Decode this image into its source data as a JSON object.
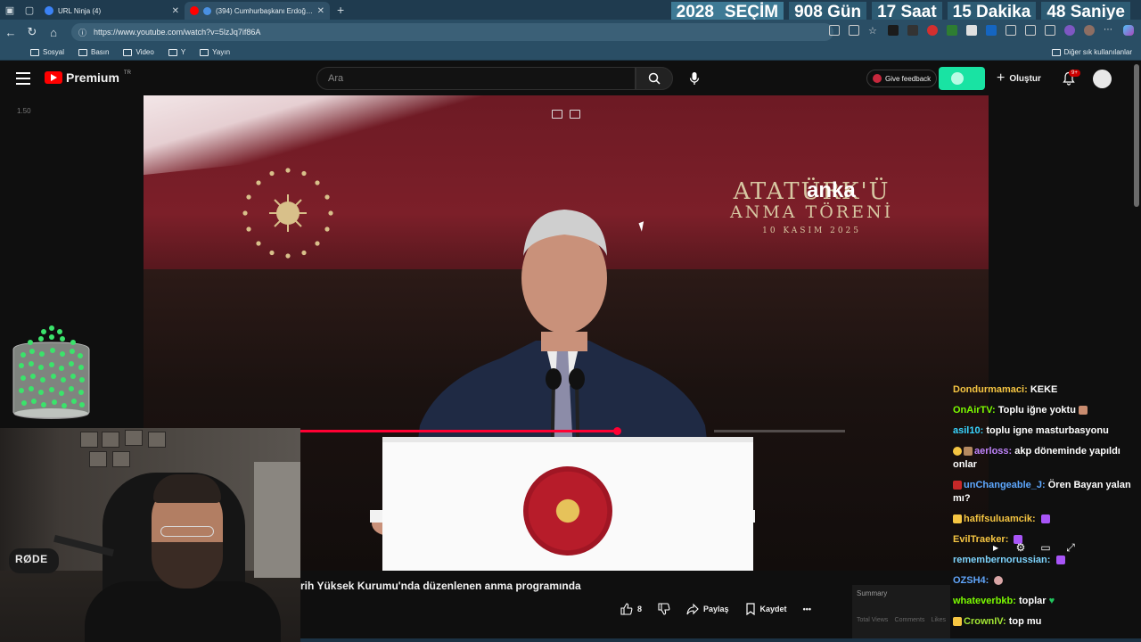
{
  "browser": {
    "tabs": [
      {
        "title": "URL Ninja (4)",
        "active": false,
        "fav_color": "#3b82f6"
      },
      {
        "title": "(394) Cumhurbaşkanı Erdoğ…",
        "active": true,
        "fav_color": "#ff0000"
      }
    ],
    "url": "https://www.youtube.com/watch?v=5lzJq7if86A",
    "bookmarks": [
      "Sosyal",
      "Basın",
      "Video",
      "Y",
      "Yayın"
    ],
    "bookmarks_right": "Diğer sık kullanılanlar"
  },
  "countdown": {
    "year": "2028",
    "label": "SEÇİM",
    "days": "908 Gün",
    "hours": "17 Saat",
    "minutes": "15 Dakika",
    "seconds": "48 Saniye"
  },
  "youtube": {
    "logo_text": "Premium",
    "logo_sup": "TR",
    "search_placeholder": "Ara",
    "feedback_label": "Give feedback",
    "create_label": "Oluştur",
    "notif_badge": "9+",
    "speed_label": "1.50"
  },
  "video": {
    "wall_title_line1": "ATATÜRK'Ü",
    "wall_title_line2": "ANMA TÖRENİ",
    "wall_title_line3": "10 KASIM 2025",
    "watermark": "anka",
    "progress": 0.68
  },
  "below": {
    "title": "rih Yüksek Kurumu'nda düzenlenen anma programında",
    "likes": "8",
    "share_label": "Paylaş",
    "save_label": "Kaydet",
    "summary_label": "Summary",
    "summary_col1": "Total Views",
    "summary_col2": "Comments",
    "summary_col3": "Likes"
  },
  "webcam": {
    "mic_brand": "RØDE"
  },
  "chat": [
    {
      "user": "Dondurmamaci:",
      "text": "KEKE",
      "color": "#f5c542"
    },
    {
      "user": "OnAirTV:",
      "text": "Toplu iğne yoktu",
      "color": "#7cfc00"
    },
    {
      "user": "asil10:",
      "text": "toplu igne masturbasyonu",
      "color": "#39d5ff"
    },
    {
      "user": "aerloss:",
      "text": "akp döneminde yapıldı onlar",
      "color": "#c084fc"
    },
    {
      "user": "unChangeable_J:",
      "text": "Ören Bayan yalan mı?",
      "color": "#5ea8ff"
    },
    {
      "user": "hafifsuluamcik:",
      "text": "",
      "color": "#f5c542"
    },
    {
      "user": "EvilTraeker:",
      "text": "",
      "color": "#f5c542"
    },
    {
      "user": "remembernorussian:",
      "text": "",
      "color": "#7dd3fc"
    },
    {
      "user": "OZSH4:",
      "text": "",
      "color": "#60a5fa"
    },
    {
      "user": "whateverbkb:",
      "text": "toplar",
      "color": "#7cfc00"
    },
    {
      "user": "CrownIV:",
      "text": "top mu",
      "color": "#a3e635"
    }
  ]
}
